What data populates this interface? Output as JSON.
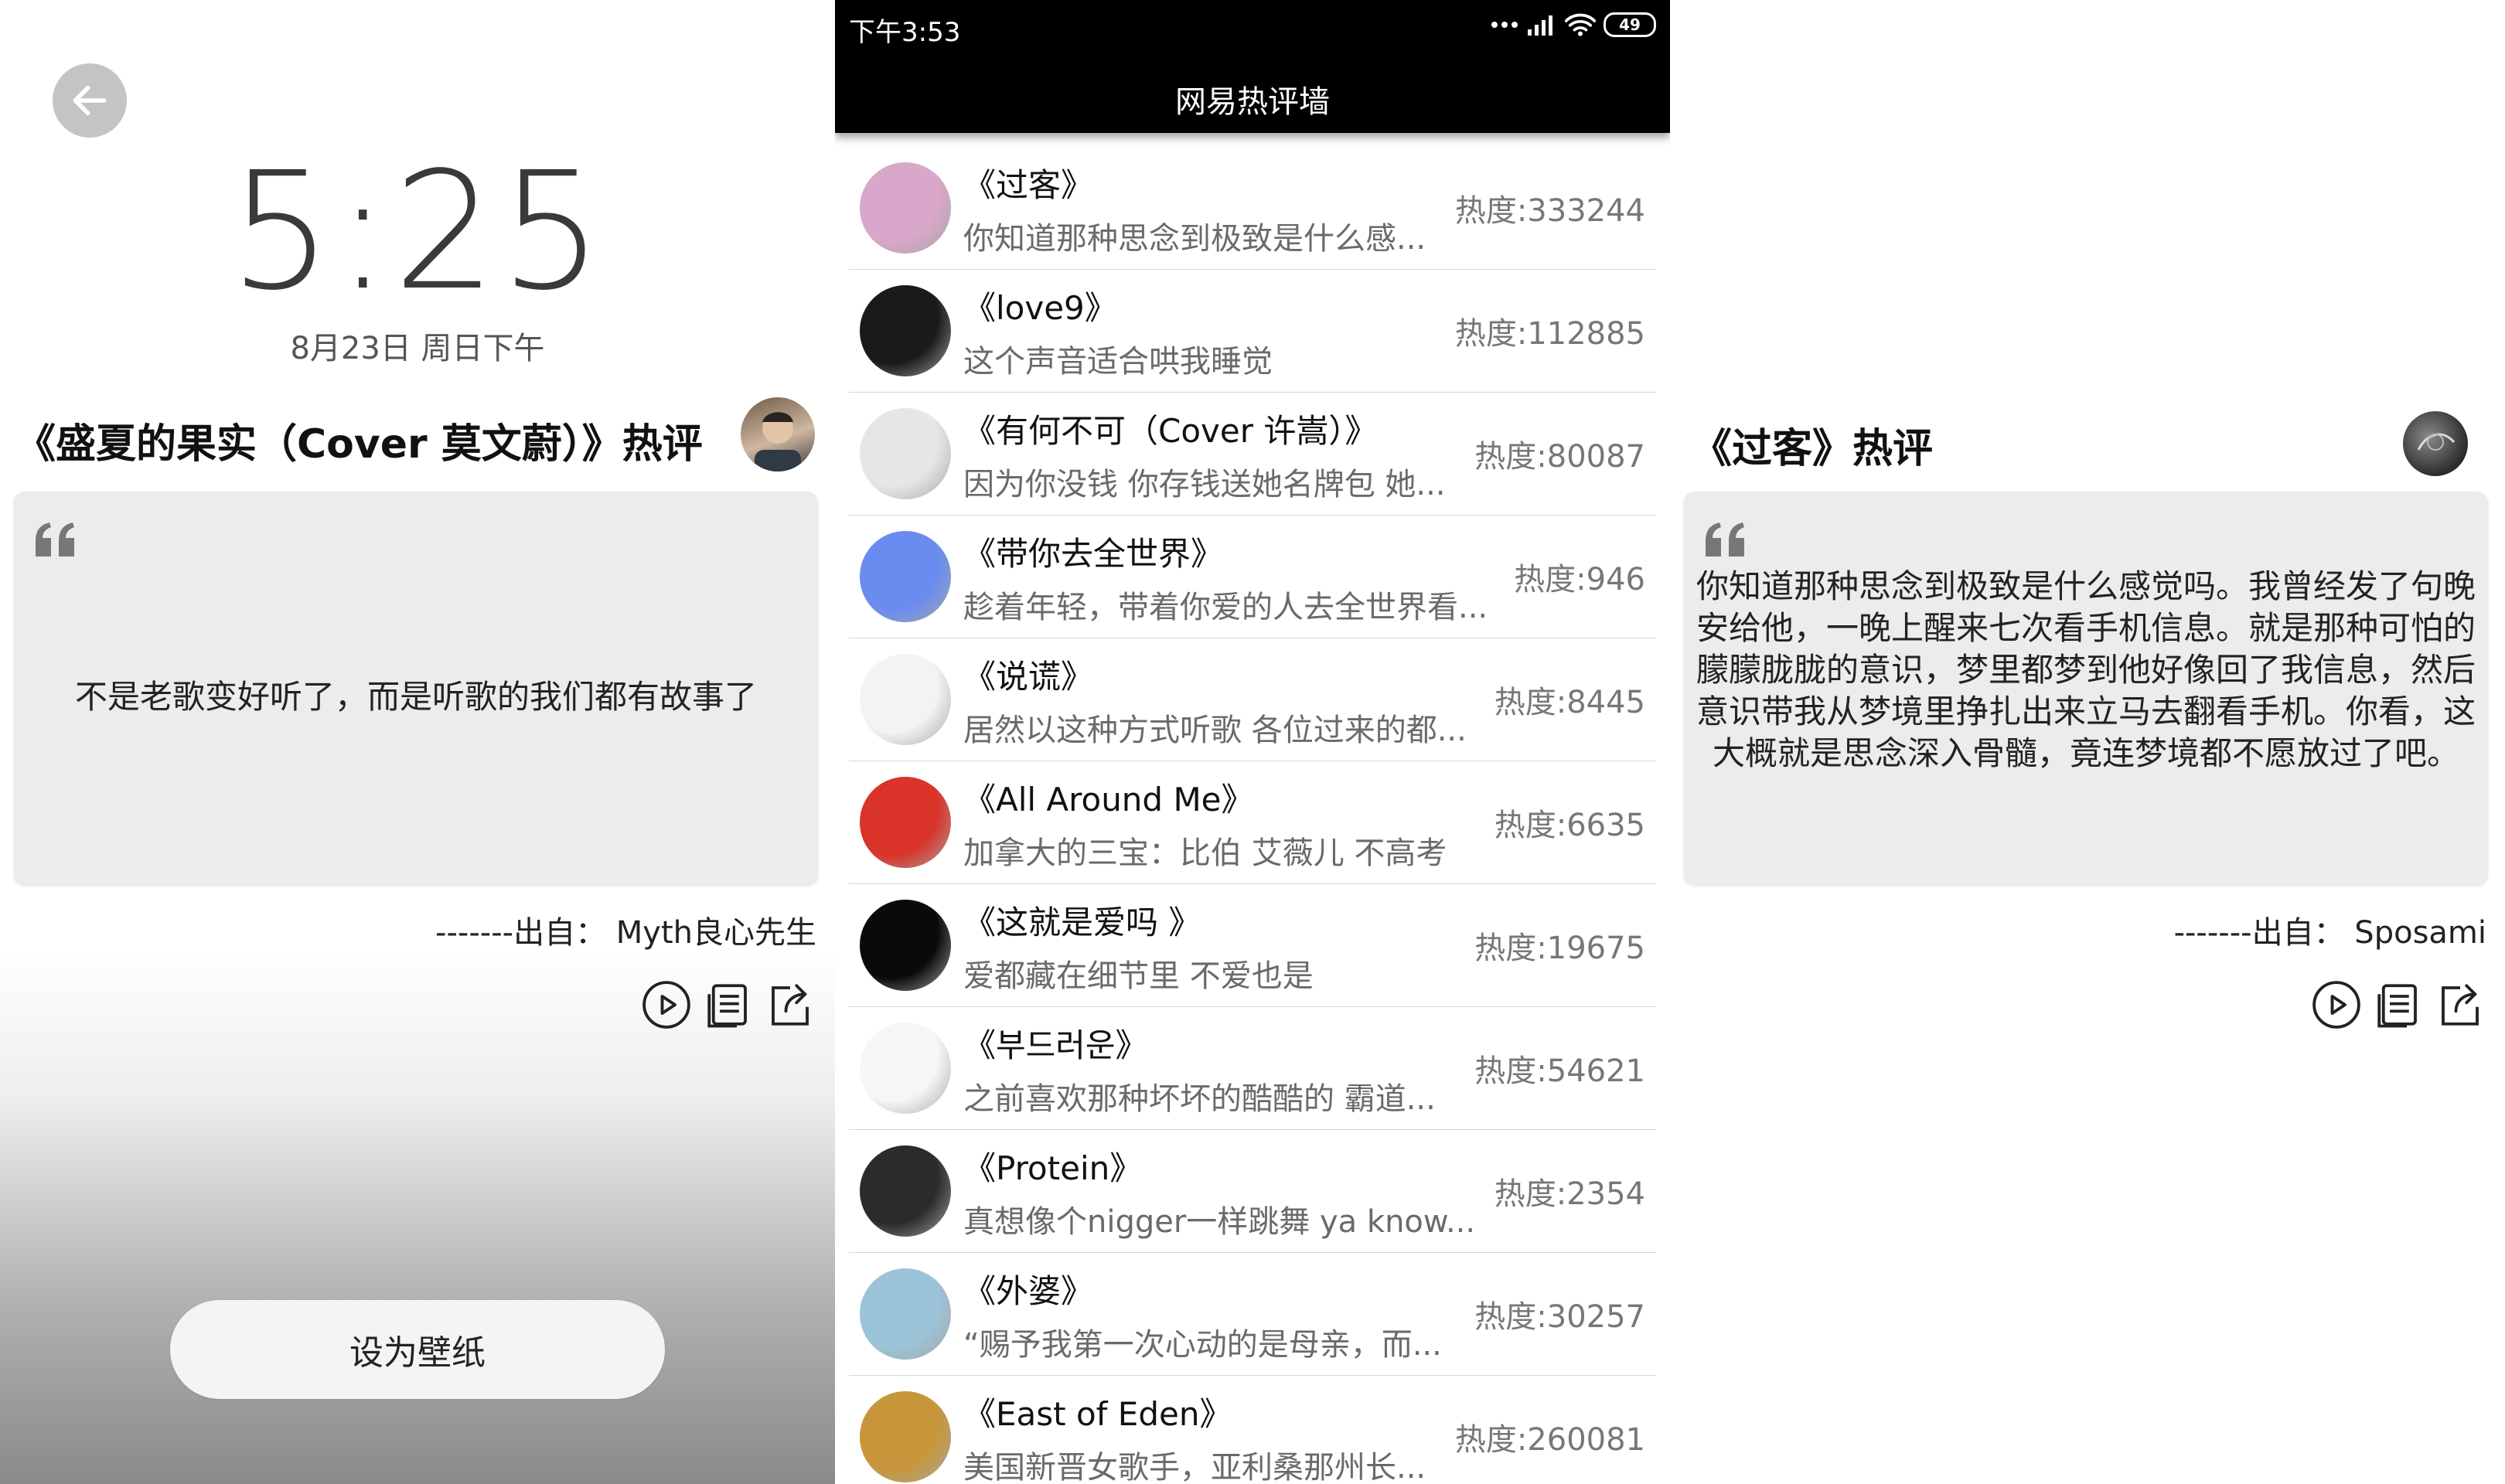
{
  "left": {
    "lock_time": "5:25",
    "lock_date": "8月23日 周日下午",
    "comment_title": "《盛夏的果实（Cover 莫文蔚）》热评",
    "quote": "不是老歌变好听了，而是听歌的我们都有故事了",
    "source": "-------出自： Myth良心先生",
    "set_wallpaper": "设为壁纸"
  },
  "middle": {
    "status_time": "下午3:53",
    "battery": "49",
    "title": "网易热评墙",
    "songs": [
      {
        "title": "《过客》",
        "preview": "你知道那种思念到极致是什么感...",
        "heat": "热度:333244",
        "cover_color": "#d9a7c9"
      },
      {
        "title": "《love9》",
        "preview": "这个声音适合哄我睡觉",
        "heat": "热度:112885",
        "cover_color": "#1a1a1a"
      },
      {
        "title": "《有何不可（Cover 许嵩）》",
        "preview": "因为你没钱 你存钱送她名牌包 她...",
        "heat": "热度:80087",
        "cover_color": "#e6e6e6"
      },
      {
        "title": "《带你去全世界》",
        "preview": "趁着年轻，带着你爱的人去全世界看...",
        "heat": "热度:946",
        "cover_color": "#6a8cf0"
      },
      {
        "title": "《说谎》",
        "preview": "居然以这种方式听歌 各位过来的都...",
        "heat": "热度:8445",
        "cover_color": "#f3f3f3"
      },
      {
        "title": "《All Around Me》",
        "preview": "加拿大的三宝：比伯 艾薇儿 不高考",
        "heat": "热度:6635",
        "cover_color": "#d9332a"
      },
      {
        "title": "《这就是爱吗 》",
        "preview": "爱都藏在细节里 不爱也是",
        "heat": "热度:19675",
        "cover_color": "#0a0a0a"
      },
      {
        "title": "《부드러운》",
        "preview": "之前喜欢那种坏坏的酷酷的 霸道...",
        "heat": "热度:54621",
        "cover_color": "#f6f6f6"
      },
      {
        "title": "《Protein》",
        "preview": "真想像个nigger一样跳舞 ya know...",
        "heat": "热度:2354",
        "cover_color": "#2b2b2b"
      },
      {
        "title": "《外婆》",
        "preview": "“赐予我第一次心动的是母亲，而...",
        "heat": "热度:30257",
        "cover_color": "#9cc4d8"
      },
      {
        "title": "《East of Eden》",
        "preview": "美国新晋女歌手，亚利桑那州长...",
        "heat": "热度:260081",
        "cover_color": "#c8963a"
      }
    ]
  },
  "right": {
    "comment_title": "《过客》热评",
    "quote": "你知道那种思念到极致是什么感觉吗。我曾经发了句晚安给他，一晚上醒来七次看手机信息。就是那种可怕的朦朦胧胧的意识，梦里都梦到他好像回了我信息，然后意识带我从梦境里挣扎出来立马去翻看手机。你看，这大概就是思念深入骨髓，竟连梦境都不愿放过了吧。",
    "source": "-------出自： Sposami"
  }
}
